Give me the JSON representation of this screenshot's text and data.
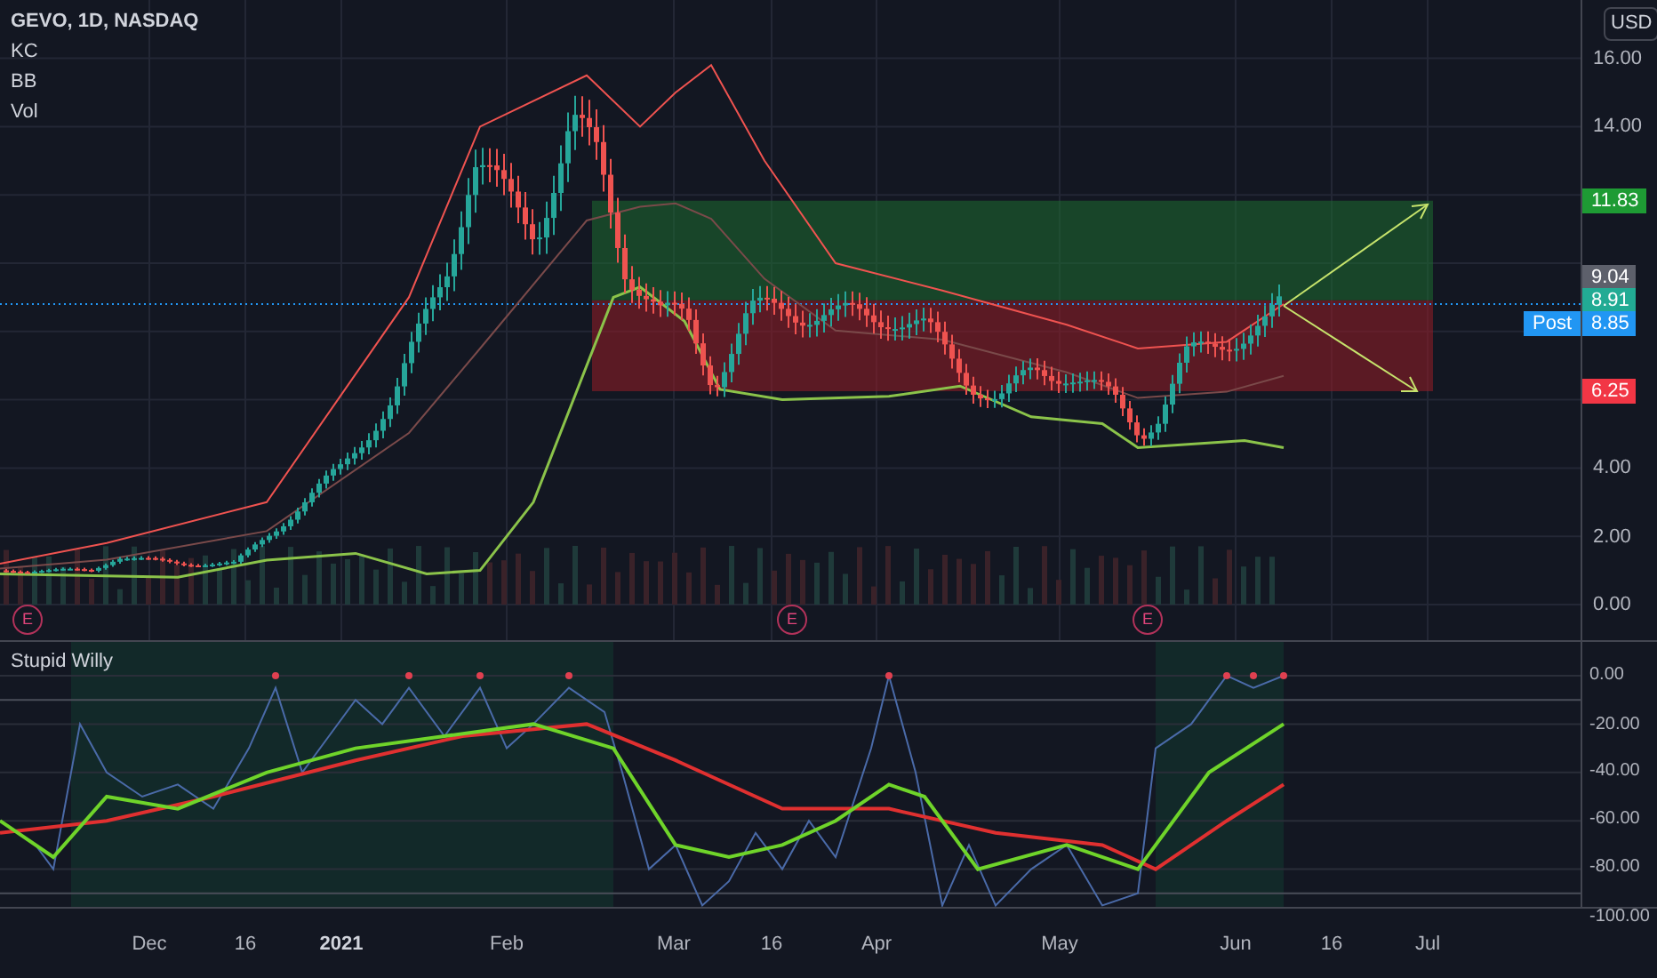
{
  "legend": {
    "title": "GEVO, 1D, NASDAQ",
    "indicators": [
      "KC",
      "BB",
      "Vol"
    ]
  },
  "currency": "USD",
  "price_axis": {
    "ticks": [
      "16.00",
      "14.00",
      "4.00",
      "2.00",
      "0.00"
    ]
  },
  "price_tags": [
    {
      "text": "11.83",
      "color": "#1e9b34"
    },
    {
      "text": "9.04",
      "color": "#5d606b"
    },
    {
      "text": "8.91",
      "color": "#22ab94"
    },
    {
      "text": "8.85",
      "label": "Post",
      "color": "#2196f3"
    },
    {
      "text": "6.25",
      "color": "#f23645"
    }
  ],
  "earnings_markers": [
    "E",
    "E",
    "E"
  ],
  "oscillator": {
    "title": "Stupid Willy",
    "ticks": [
      "0.00",
      "-20.00",
      "-40.00",
      "-60.00",
      "-80.00",
      "-100.00"
    ]
  },
  "time_axis": [
    {
      "text": "Dec",
      "kind": "month"
    },
    {
      "text": "16",
      "kind": "day"
    },
    {
      "text": "2021",
      "kind": "year"
    },
    {
      "text": "Feb",
      "kind": "month"
    },
    {
      "text": "Mar",
      "kind": "month"
    },
    {
      "text": "16",
      "kind": "day"
    },
    {
      "text": "Apr",
      "kind": "month"
    },
    {
      "text": "May",
      "kind": "month"
    },
    {
      "text": "Jun",
      "kind": "month"
    },
    {
      "text": "16",
      "kind": "day"
    },
    {
      "text": "Jul",
      "kind": "month"
    }
  ]
}
